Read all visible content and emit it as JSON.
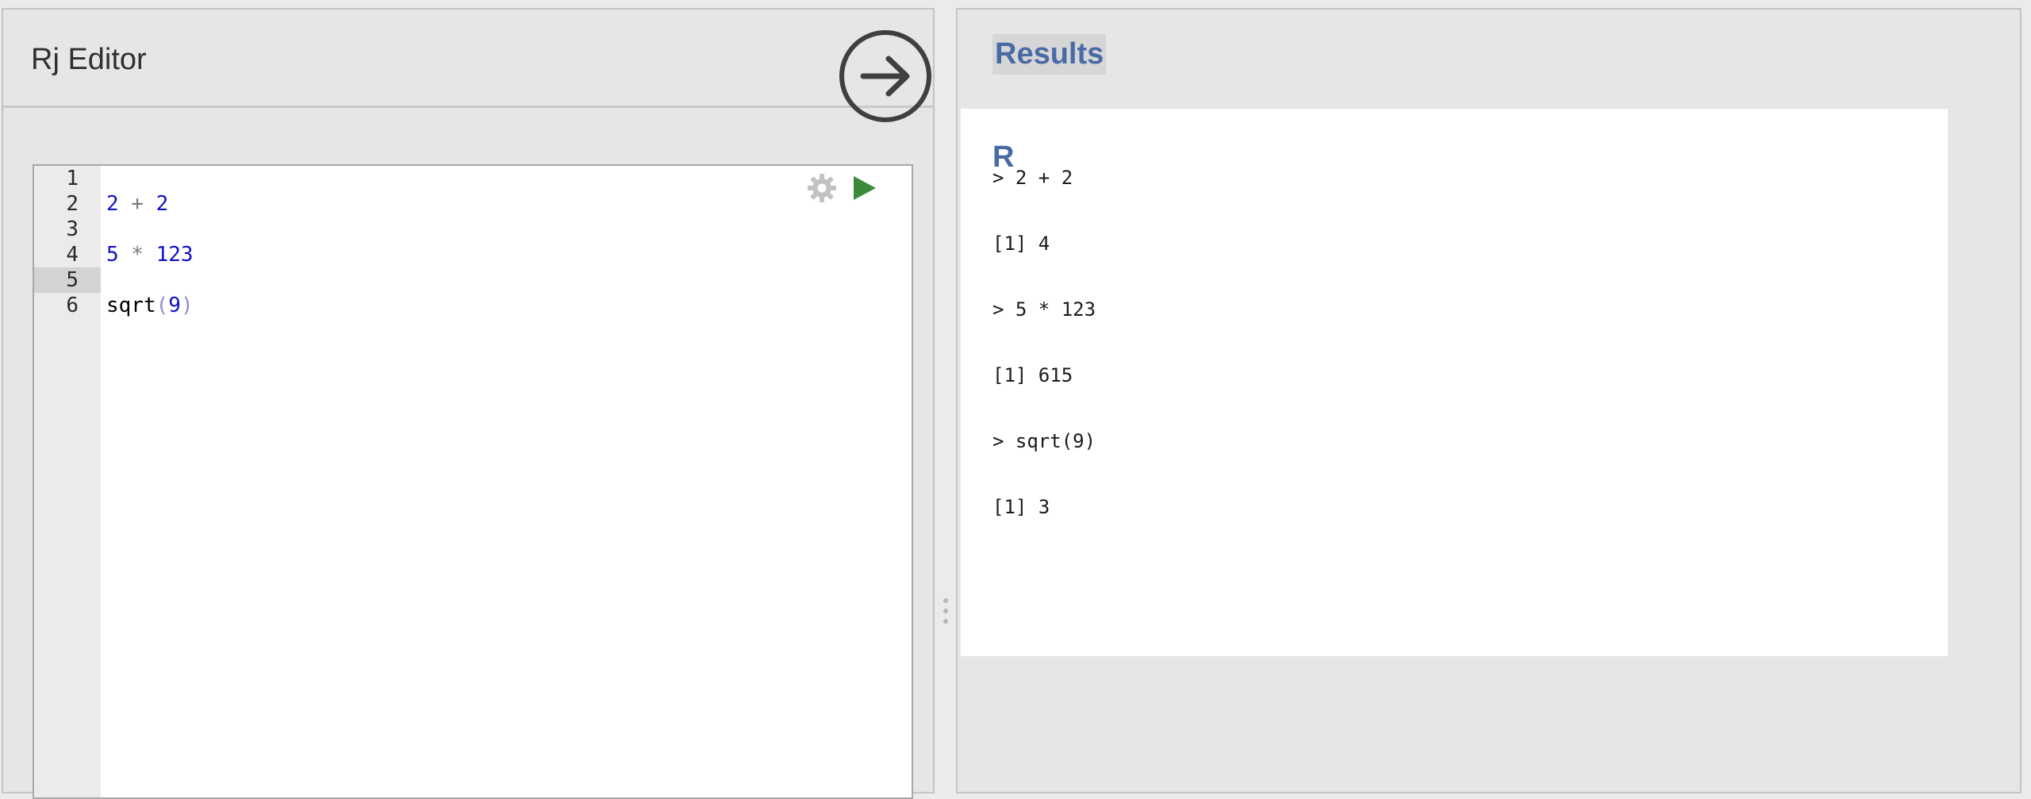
{
  "editor": {
    "title": "Rj Editor",
    "run_button_icon": "arrow-right-circle-icon",
    "settings_icon": "gear-icon",
    "run_code_icon": "play-icon",
    "active_line": 5,
    "lines": [
      {
        "num": "1",
        "tokens": []
      },
      {
        "num": "2",
        "tokens": [
          {
            "text": "2",
            "kind": "num"
          },
          {
            "text": " + ",
            "kind": "op"
          },
          {
            "text": "2",
            "kind": "num"
          }
        ]
      },
      {
        "num": "3",
        "tokens": []
      },
      {
        "num": "4",
        "tokens": [
          {
            "text": "5",
            "kind": "num"
          },
          {
            "text": " * ",
            "kind": "op"
          },
          {
            "text": "123",
            "kind": "num"
          }
        ]
      },
      {
        "num": "5",
        "tokens": []
      },
      {
        "num": "6",
        "tokens": [
          {
            "text": "sqrt",
            "kind": "fn"
          },
          {
            "text": "(",
            "kind": "paren"
          },
          {
            "text": "9",
            "kind": "num"
          },
          {
            "text": ")",
            "kind": "paren"
          }
        ]
      }
    ]
  },
  "results": {
    "title": "Results",
    "language": "R",
    "output": [
      "> 2 + 2",
      "[1] 4",
      "> 5 * 123",
      "[1] 615",
      "> sqrt(9)",
      "[1] 3"
    ]
  },
  "colors": {
    "accent_blue": "#4a6aa6",
    "play_green": "#3a8a3a",
    "number_blue": "#1010c8"
  }
}
